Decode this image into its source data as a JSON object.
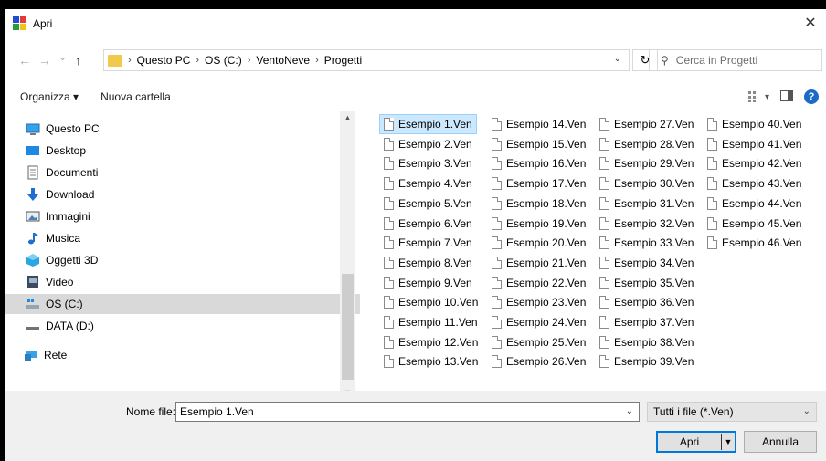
{
  "window": {
    "title": "Apri",
    "close": "✕"
  },
  "nav": {
    "back": "←",
    "forward": "→",
    "recent": "⌄",
    "up": "↑",
    "breadcrumb": [
      "Questo PC",
      "OS (C:)",
      "VentoNeve",
      "Progetti"
    ],
    "separator": "›",
    "address_dropdown": "⌄",
    "refresh": "↻",
    "search_placeholder": "Cerca in Progetti"
  },
  "toolbar": {
    "organize": "Organizza ▾",
    "new_folder": "Nuova cartella",
    "view": "▾",
    "help": "?"
  },
  "sidebar": {
    "items": [
      {
        "label": "Questo PC",
        "icon": "pc-icon"
      },
      {
        "label": "Desktop",
        "icon": "desktop-icon"
      },
      {
        "label": "Documenti",
        "icon": "documents-icon"
      },
      {
        "label": "Download",
        "icon": "download-icon"
      },
      {
        "label": "Immagini",
        "icon": "images-icon"
      },
      {
        "label": "Musica",
        "icon": "music-icon"
      },
      {
        "label": "Oggetti 3D",
        "icon": "objects3d-icon"
      },
      {
        "label": "Video",
        "icon": "video-icon"
      },
      {
        "label": "OS (C:)",
        "icon": "drive-c-icon",
        "selected": true
      },
      {
        "label": "DATA (D:)",
        "icon": "drive-d-icon"
      },
      {
        "label": "Rete",
        "icon": "network-icon"
      }
    ]
  },
  "files": {
    "selected": "Esempio 1.Ven",
    "columns": [
      [
        "Esempio 1.Ven",
        "Esempio 2.Ven",
        "Esempio 3.Ven",
        "Esempio 4.Ven",
        "Esempio 5.Ven",
        "Esempio 6.Ven",
        "Esempio 7.Ven",
        "Esempio 8.Ven",
        "Esempio 9.Ven",
        "Esempio 10.Ven",
        "Esempio 11.Ven",
        "Esempio 12.Ven",
        "Esempio 13.Ven"
      ],
      [
        "Esempio 14.Ven",
        "Esempio 15.Ven",
        "Esempio 16.Ven",
        "Esempio 17.Ven",
        "Esempio 18.Ven",
        "Esempio 19.Ven",
        "Esempio 20.Ven",
        "Esempio 21.Ven",
        "Esempio 22.Ven",
        "Esempio 23.Ven",
        "Esempio 24.Ven",
        "Esempio 25.Ven",
        "Esempio 26.Ven"
      ],
      [
        "Esempio 27.Ven",
        "Esempio 28.Ven",
        "Esempio 29.Ven",
        "Esempio 30.Ven",
        "Esempio 31.Ven",
        "Esempio 32.Ven",
        "Esempio 33.Ven",
        "Esempio 34.Ven",
        "Esempio 35.Ven",
        "Esempio 36.Ven",
        "Esempio 37.Ven",
        "Esempio 38.Ven",
        "Esempio 39.Ven"
      ],
      [
        "Esempio 40.Ven",
        "Esempio 41.Ven",
        "Esempio 42.Ven",
        "Esempio 43.Ven",
        "Esempio 44.Ven",
        "Esempio 45.Ven",
        "Esempio 46.Ven"
      ]
    ]
  },
  "bottom": {
    "filename_label": "Nome file:",
    "filename_value": "Esempio 1.Ven",
    "filter_value": "Tutti i file (*.Ven)",
    "open_label": "Apri",
    "cancel_label": "Annulla"
  },
  "colors": {
    "accent": "#0078d7",
    "selection": "#cce8ff",
    "help": "#1b6ac9",
    "folder": "#f2c94c"
  }
}
